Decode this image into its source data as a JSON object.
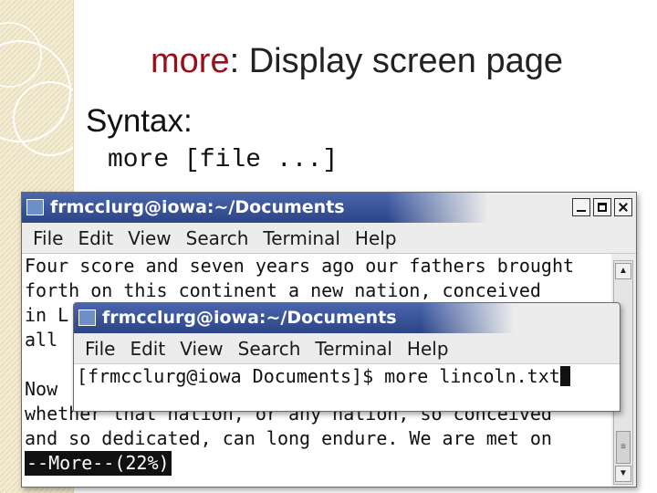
{
  "slide": {
    "title_cmd": "more",
    "title_rest": ": Display screen page",
    "syntax_heading": "Syntax:",
    "syntax_line": "more [file ...]"
  },
  "window_back": {
    "title": "frmcclurg@iowa:~/Documents",
    "menu": [
      "File",
      "Edit",
      "View",
      "Search",
      "Terminal",
      "Help"
    ],
    "lines": [
      "Four score and seven years ago our fathers brought",
      "forth on this continent a new nation, conceived",
      "in L",
      "all",
      "",
      "Now",
      "whether that nation, or any nation, so conceived",
      "and so dedicated, can long endure. We are met on"
    ],
    "more_prompt": "--More--(22%)"
  },
  "window_front": {
    "title": "frmcclurg@iowa:~/Documents",
    "menu": [
      "File",
      "Edit",
      "View",
      "Search",
      "Terminal",
      "Help"
    ],
    "command_line": "[frmcclurg@iowa Documents]$ more lincoln.txt"
  },
  "colors": {
    "title_accent": "#9b0f1a",
    "titlebar": "#2b4586",
    "deco_background": "#f3ead2"
  },
  "icons": [
    "terminal-icon",
    "minimize-icon",
    "maximize-icon",
    "close-icon",
    "scroll-up-icon",
    "scroll-down-icon",
    "scroll-thumb-grip-icon"
  ]
}
